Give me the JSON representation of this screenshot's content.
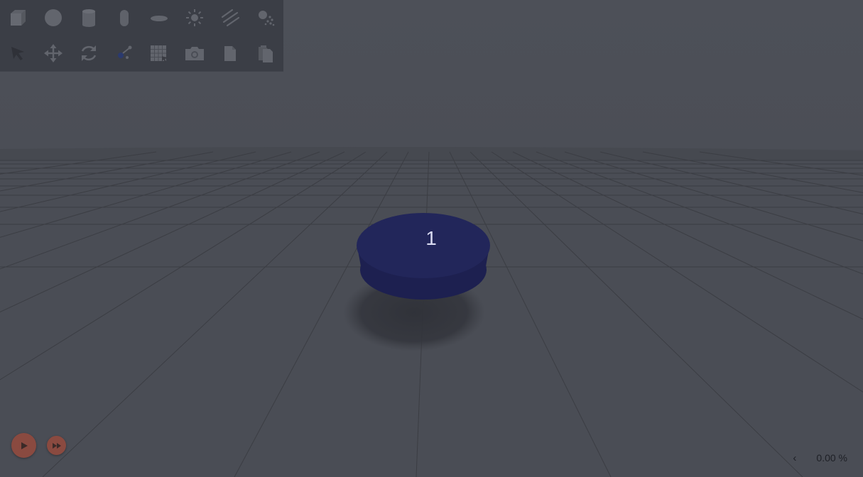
{
  "toolbar": {
    "row1": [
      {
        "name": "box-icon"
      },
      {
        "name": "sphere-icon"
      },
      {
        "name": "cylinder-icon"
      },
      {
        "name": "capsule-icon"
      },
      {
        "name": "ellipsoid-icon"
      },
      {
        "name": "sun-light-icon"
      },
      {
        "name": "directional-light-icon"
      },
      {
        "name": "spot-light-icon"
      }
    ],
    "row2": [
      {
        "name": "select-arrow-icon"
      },
      {
        "name": "translate-icon"
      },
      {
        "name": "rotate-icon"
      },
      {
        "name": "scale-icon"
      },
      {
        "name": "grid-snap-icon"
      },
      {
        "name": "camera-icon"
      },
      {
        "name": "copy-icon"
      },
      {
        "name": "paste-icon"
      }
    ]
  },
  "scene": {
    "object_label": "1",
    "object_color": "#22265a",
    "ground_color": "#4a4d55",
    "sky_color": "#4c4f57"
  },
  "playback": {
    "play_icon": "play-icon",
    "fast_forward_icon": "fast-forward-icon",
    "accent_color": "#8a4a40"
  },
  "progress": {
    "chevron": "‹",
    "value_text": "0.00 %"
  }
}
